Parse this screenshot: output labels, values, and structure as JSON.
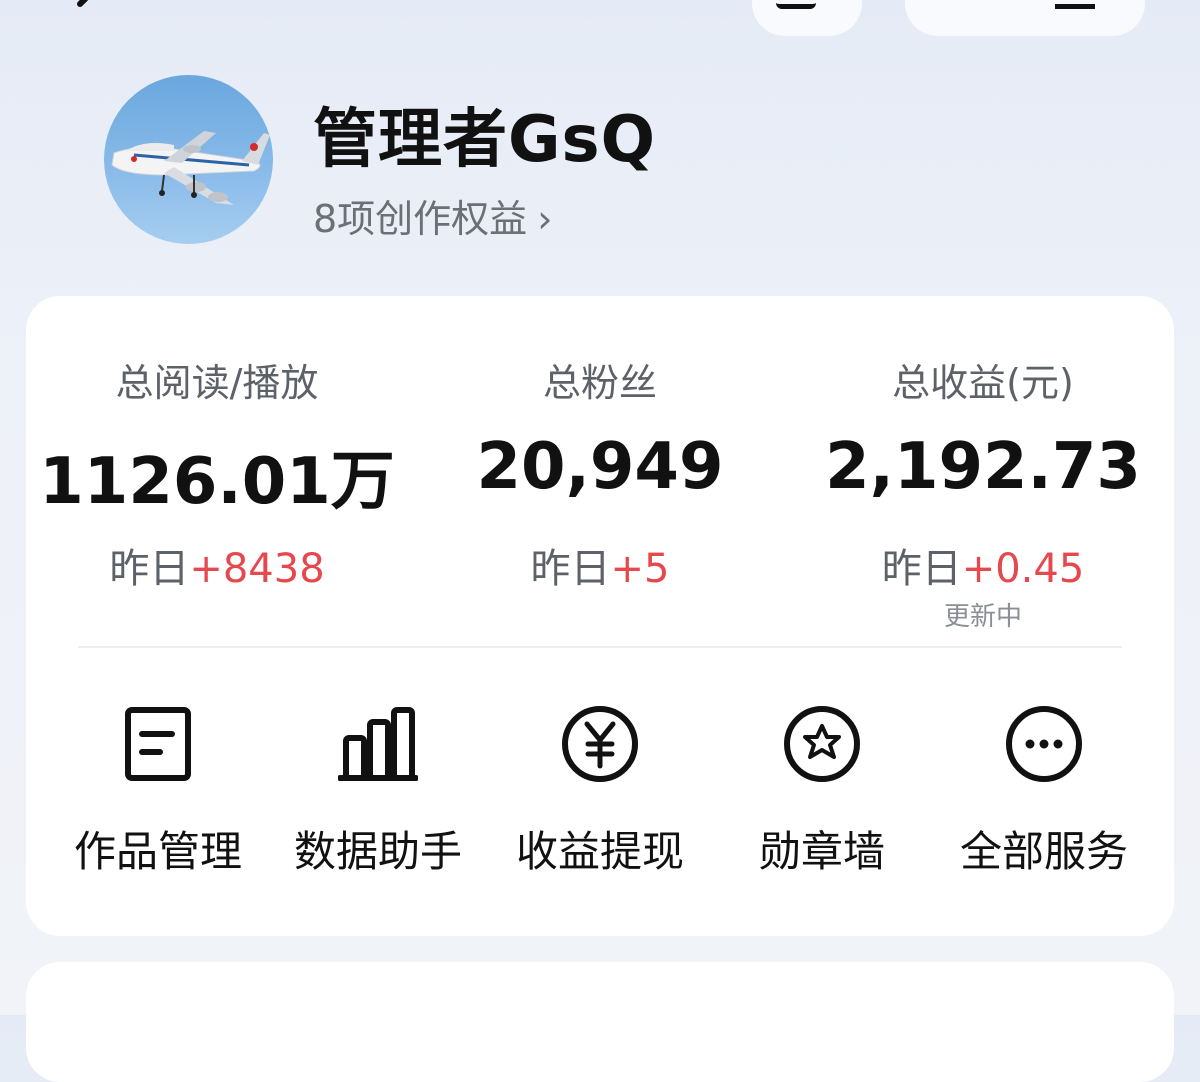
{
  "profile": {
    "name": "管理者GsQ",
    "rights_label": "8项创作权益"
  },
  "stats": [
    {
      "label": "总阅读/播放",
      "value": "1126.01万",
      "delta_prefix": "昨日",
      "delta": "+8438"
    },
    {
      "label": "总粉丝",
      "value": "20,949",
      "delta_prefix": "昨日",
      "delta": "+5"
    },
    {
      "label": "总收益(元)",
      "value": "2,192.73",
      "delta_prefix": "昨日",
      "delta": "+0.45",
      "update_status": "更新中"
    }
  ],
  "services": [
    {
      "label": "作品管理",
      "icon": "works-management-icon"
    },
    {
      "label": "数据助手",
      "icon": "data-assistant-icon"
    },
    {
      "label": "收益提现",
      "icon": "yuan-withdraw-icon"
    },
    {
      "label": "勋章墙",
      "icon": "medal-wall-icon"
    },
    {
      "label": "全部服务",
      "icon": "more-services-icon"
    }
  ],
  "bottom_card": {
    "text": ""
  },
  "colors": {
    "accent_red": "#e5484d",
    "background": "#edf1f8",
    "card": "#ffffff"
  }
}
